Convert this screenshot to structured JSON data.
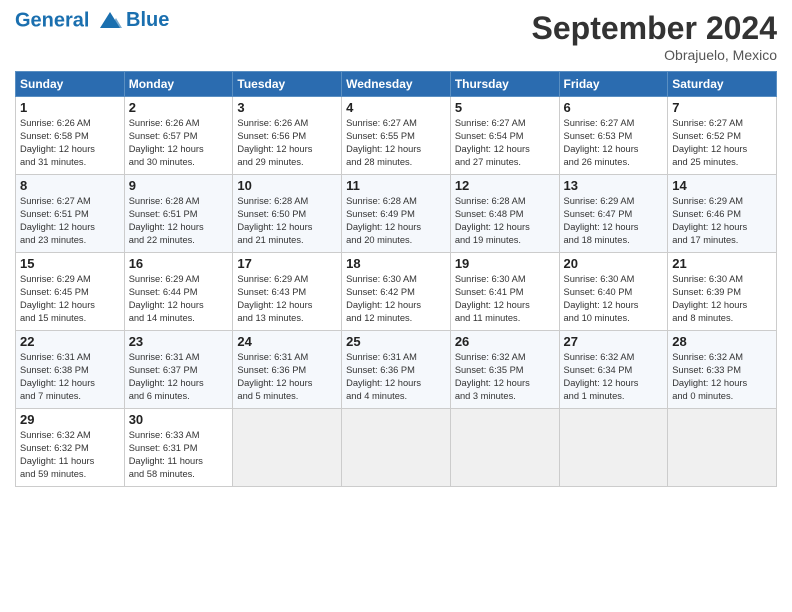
{
  "header": {
    "logo_line1": "General",
    "logo_line2": "Blue",
    "month_title": "September 2024",
    "location": "Obrajuelo, Mexico"
  },
  "days_of_week": [
    "Sunday",
    "Monday",
    "Tuesday",
    "Wednesday",
    "Thursday",
    "Friday",
    "Saturday"
  ],
  "weeks": [
    [
      {
        "num": "1",
        "rise": "6:26 AM",
        "set": "6:58 PM",
        "hours": "12",
        "mins": "31"
      },
      {
        "num": "2",
        "rise": "6:26 AM",
        "set": "6:57 PM",
        "hours": "12",
        "mins": "30"
      },
      {
        "num": "3",
        "rise": "6:26 AM",
        "set": "6:56 PM",
        "hours": "12",
        "mins": "29"
      },
      {
        "num": "4",
        "rise": "6:27 AM",
        "set": "6:55 PM",
        "hours": "12",
        "mins": "28"
      },
      {
        "num": "5",
        "rise": "6:27 AM",
        "set": "6:54 PM",
        "hours": "12",
        "mins": "27"
      },
      {
        "num": "6",
        "rise": "6:27 AM",
        "set": "6:53 PM",
        "hours": "12",
        "mins": "26"
      },
      {
        "num": "7",
        "rise": "6:27 AM",
        "set": "6:52 PM",
        "hours": "12",
        "mins": "25"
      }
    ],
    [
      {
        "num": "8",
        "rise": "6:27 AM",
        "set": "6:51 PM",
        "hours": "12",
        "mins": "23"
      },
      {
        "num": "9",
        "rise": "6:28 AM",
        "set": "6:51 PM",
        "hours": "12",
        "mins": "22"
      },
      {
        "num": "10",
        "rise": "6:28 AM",
        "set": "6:50 PM",
        "hours": "12",
        "mins": "21"
      },
      {
        "num": "11",
        "rise": "6:28 AM",
        "set": "6:49 PM",
        "hours": "12",
        "mins": "20"
      },
      {
        "num": "12",
        "rise": "6:28 AM",
        "set": "6:48 PM",
        "hours": "12",
        "mins": "19"
      },
      {
        "num": "13",
        "rise": "6:29 AM",
        "set": "6:47 PM",
        "hours": "12",
        "mins": "18"
      },
      {
        "num": "14",
        "rise": "6:29 AM",
        "set": "6:46 PM",
        "hours": "12",
        "mins": "17"
      }
    ],
    [
      {
        "num": "15",
        "rise": "6:29 AM",
        "set": "6:45 PM",
        "hours": "12",
        "mins": "15"
      },
      {
        "num": "16",
        "rise": "6:29 AM",
        "set": "6:44 PM",
        "hours": "12",
        "mins": "14"
      },
      {
        "num": "17",
        "rise": "6:29 AM",
        "set": "6:43 PM",
        "hours": "12",
        "mins": "13"
      },
      {
        "num": "18",
        "rise": "6:30 AM",
        "set": "6:42 PM",
        "hours": "12",
        "mins": "12"
      },
      {
        "num": "19",
        "rise": "6:30 AM",
        "set": "6:41 PM",
        "hours": "12",
        "mins": "11"
      },
      {
        "num": "20",
        "rise": "6:30 AM",
        "set": "6:40 PM",
        "hours": "12",
        "mins": "10"
      },
      {
        "num": "21",
        "rise": "6:30 AM",
        "set": "6:39 PM",
        "hours": "12",
        "mins": "8"
      }
    ],
    [
      {
        "num": "22",
        "rise": "6:31 AM",
        "set": "6:38 PM",
        "hours": "12",
        "mins": "7"
      },
      {
        "num": "23",
        "rise": "6:31 AM",
        "set": "6:37 PM",
        "hours": "12",
        "mins": "6"
      },
      {
        "num": "24",
        "rise": "6:31 AM",
        "set": "6:36 PM",
        "hours": "12",
        "mins": "5"
      },
      {
        "num": "25",
        "rise": "6:31 AM",
        "set": "6:36 PM",
        "hours": "12",
        "mins": "4"
      },
      {
        "num": "26",
        "rise": "6:32 AM",
        "set": "6:35 PM",
        "hours": "12",
        "mins": "3"
      },
      {
        "num": "27",
        "rise": "6:32 AM",
        "set": "6:34 PM",
        "hours": "12",
        "mins": "1"
      },
      {
        "num": "28",
        "rise": "6:32 AM",
        "set": "6:33 PM",
        "hours": "12",
        "mins": "0"
      }
    ],
    [
      {
        "num": "29",
        "rise": "6:32 AM",
        "set": "6:32 PM",
        "hours": "11",
        "mins": "59"
      },
      {
        "num": "30",
        "rise": "6:33 AM",
        "set": "6:31 PM",
        "hours": "11",
        "mins": "58"
      },
      null,
      null,
      null,
      null,
      null
    ]
  ]
}
